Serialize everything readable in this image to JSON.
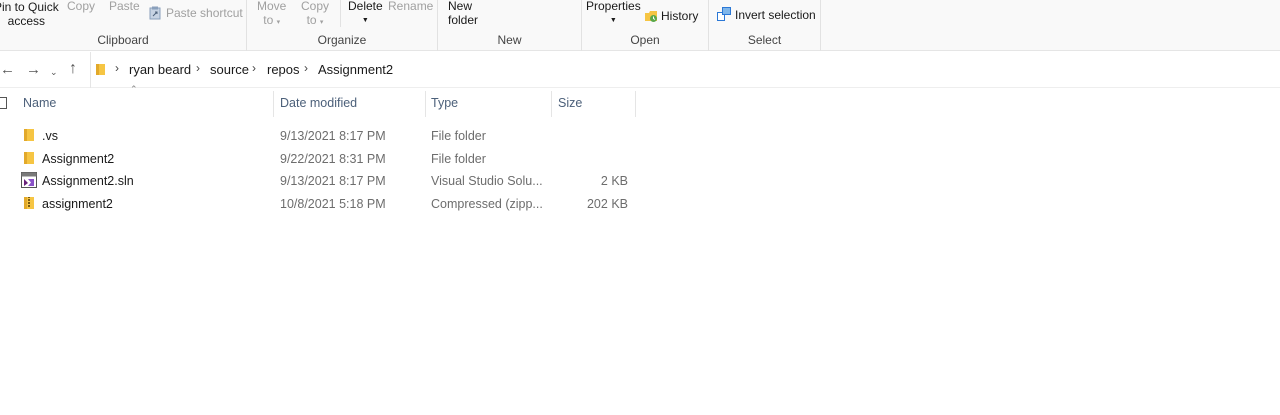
{
  "ribbon": {
    "clipboard": {
      "pin_line1": "Pin to Quick",
      "pin_line2": "access",
      "copy": "Copy",
      "paste": "Paste",
      "paste_shortcut": "Paste shortcut",
      "label": "Clipboard"
    },
    "organize": {
      "move_line1": "Move",
      "move_line2": "to",
      "copy_line1": "Copy",
      "copy_line2": "to",
      "delete": "Delete",
      "rename": "Rename",
      "label": "Organize"
    },
    "new": {
      "folder_line1": "New",
      "folder_line2": "folder",
      "label": "New"
    },
    "open": {
      "properties": "Properties",
      "history": "History",
      "label": "Open"
    },
    "select": {
      "invert": "Invert selection",
      "label": "Select"
    }
  },
  "breadcrumb": [
    "ryan beard",
    "source",
    "repos",
    "Assignment2"
  ],
  "columns": {
    "name": "Name",
    "date": "Date modified",
    "type": "Type",
    "size": "Size"
  },
  "files": [
    {
      "name": ".vs",
      "date": "9/13/2021 8:17 PM",
      "type": "File folder",
      "size": "",
      "icon": "folder-icon"
    },
    {
      "name": "Assignment2",
      "date": "9/22/2021 8:31 PM",
      "type": "File folder",
      "size": "",
      "icon": "folder-icon"
    },
    {
      "name": "Assignment2.sln",
      "date": "9/13/2021 8:17 PM",
      "type": "Visual Studio Solu...",
      "size": "2 KB",
      "icon": "visual-studio-solution-icon"
    },
    {
      "name": "assignment2",
      "date": "10/8/2021 5:18 PM",
      "type": "Compressed (zipp...",
      "size": "202 KB",
      "icon": "zip-folder-icon"
    }
  ],
  "colors": {
    "header_text": "#4c607a",
    "folder_yellow": "#f6c543",
    "accent_blue": "#2b78d6"
  }
}
